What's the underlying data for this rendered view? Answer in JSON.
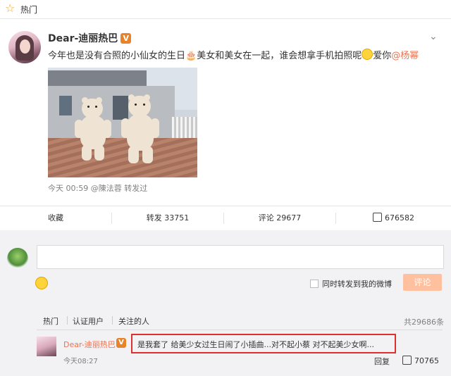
{
  "topbar": {
    "icon": "star-icon",
    "title": "热门"
  },
  "post": {
    "username": "Dear-迪丽热巴",
    "verified_badge": "V",
    "text_main": "今年也是没有合照的小仙女的生日",
    "text_mid": "美女和美女在一起，谁会想拿手机拍照呢",
    "text_love": "爱你",
    "mention": "@杨幂",
    "meta": "今天 00:59 @陳法蓉 转发过"
  },
  "actions": {
    "favorite": "收藏",
    "repost": "转发 33751",
    "comment": "评论 29677",
    "like": "676582"
  },
  "composer": {
    "placeholder": "",
    "forward_label": "同时转发到我的微博",
    "submit_label": "评论"
  },
  "comment_tabs": {
    "hot": "热门",
    "verified": "认证用户",
    "following": "关注的人",
    "total": "共29686条"
  },
  "top_comment": {
    "username": "Dear-迪丽热巴",
    "verified_badge": "V",
    "text": "是我套了 给美少女过生日闹了小插曲...对不起小蔡 对不起美少女啊...",
    "time": "今天08:27",
    "reply_label": "回复",
    "likes": "70765"
  },
  "colors": {
    "accent": "#eb7350",
    "badge": "#e8832a",
    "highlight_border": "#e0302e",
    "submit_button": "#ffc09f"
  }
}
